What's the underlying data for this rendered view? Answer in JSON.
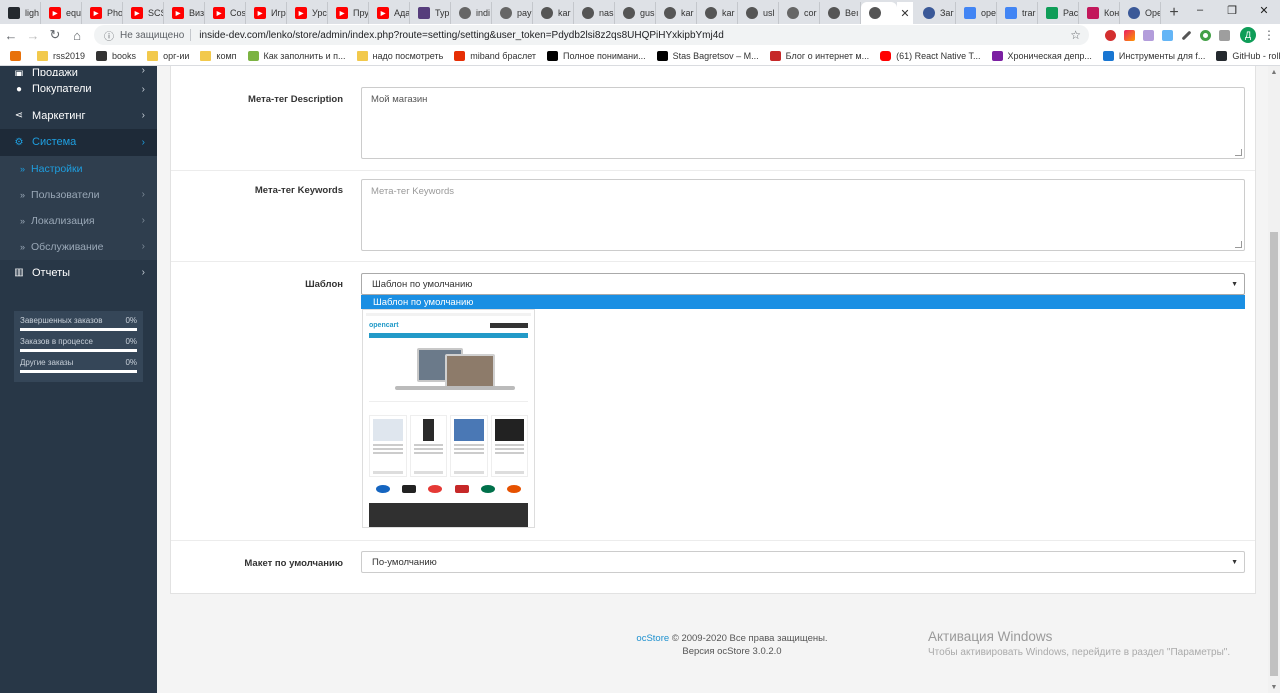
{
  "browser": {
    "tabs": [
      {
        "title": "ligh",
        "icon": "github-icon",
        "color": "#24292e"
      },
      {
        "title": "equ",
        "icon": "youtube-icon",
        "color": "#ff0000"
      },
      {
        "title": "Pho",
        "icon": "youtube-icon",
        "color": "#ff0000"
      },
      {
        "title": "SCS",
        "icon": "youtube-icon",
        "color": "#ff0000"
      },
      {
        "title": "Виз",
        "icon": "youtube-icon",
        "color": "#ff0000"
      },
      {
        "title": "Cos",
        "icon": "youtube-icon",
        "color": "#ff0000"
      },
      {
        "title": "Игр",
        "icon": "youtube-icon",
        "color": "#ff0000"
      },
      {
        "title": "Урс",
        "icon": "youtube-icon",
        "color": "#ff0000"
      },
      {
        "title": "Пру",
        "icon": "youtube-icon",
        "color": "#ff0000"
      },
      {
        "title": "Ада",
        "icon": "youtube-icon",
        "color": "#ff0000"
      },
      {
        "title": "Тур",
        "icon": "bootstrap-icon",
        "color": "#563d7c"
      },
      {
        "title": "indi",
        "icon": "globe-icon",
        "color": "#666666"
      },
      {
        "title": "pay",
        "icon": "globe-icon",
        "color": "#666666"
      },
      {
        "title": "kar",
        "icon": "link-icon",
        "color": "#555555"
      },
      {
        "title": "nas",
        "icon": "link-icon",
        "color": "#555555"
      },
      {
        "title": "gus",
        "icon": "link-icon",
        "color": "#555555"
      },
      {
        "title": "kar",
        "icon": "link-icon",
        "color": "#555555"
      },
      {
        "title": "kar",
        "icon": "link-icon",
        "color": "#555555"
      },
      {
        "title": "usl",
        "icon": "link-icon",
        "color": "#555555"
      },
      {
        "title": "cor",
        "icon": "globe-icon",
        "color": "#666666"
      },
      {
        "title": "Веı",
        "icon": "link-icon",
        "color": "#555555"
      }
    ],
    "tabs_after": [
      {
        "title": "Заг",
        "icon": "opera-icon",
        "color": "#3b5998"
      },
      {
        "title": "ope",
        "icon": "google-icon",
        "color": "#4285f4"
      },
      {
        "title": "trar",
        "icon": "google-icon",
        "color": "#4285f4"
      },
      {
        "title": "Рас",
        "icon": "drive-icon",
        "color": "#0f9d58"
      },
      {
        "title": "Кон",
        "icon": "calendar-icon",
        "color": "#c2185b"
      },
      {
        "title": "Ope",
        "icon": "globe-icon",
        "color": "#3b5998"
      }
    ],
    "close_tab": "✕",
    "new_tab": "+",
    "window_controls": [
      "–",
      "❐",
      "✕"
    ],
    "security_label": "Не защищено",
    "url": "inside-dev.com/lenko/store/admin/index.php?route=setting/setting&user_token=Pdydb2lsi8z2qs8UHQPiHYxkipbYmj4d",
    "profile_initial": "Д",
    "bookmarks": [
      {
        "label": "",
        "icon": "apps-icon",
        "color": "#e8710a"
      },
      {
        "label": "rss2019",
        "icon": "folder-icon",
        "color": "#f2c94c"
      },
      {
        "label": "books",
        "icon": "books-icon",
        "color": "#333333"
      },
      {
        "label": "орг-ии",
        "icon": "folder-icon",
        "color": "#f2c94c"
      },
      {
        "label": "комп",
        "icon": "folder-icon",
        "color": "#f2c94c"
      },
      {
        "label": "Как заполнить и п...",
        "icon": "gear-icon",
        "color": "#7cb342"
      },
      {
        "label": "надо посмотреть",
        "icon": "folder-icon",
        "color": "#f2c94c"
      },
      {
        "label": "miband браслет",
        "icon": "aliexpress-icon",
        "color": "#e62e04"
      },
      {
        "label": "Полное понимани...",
        "icon": "medium-icon",
        "color": "#000000"
      },
      {
        "label": "Stas Bagretsov – M...",
        "icon": "medium-icon",
        "color": "#000000"
      },
      {
        "label": "Блог о интернет м...",
        "icon": "blog-icon",
        "color": "#c62828"
      },
      {
        "label": "(61) React Native T...",
        "icon": "youtube-icon",
        "color": "#ff0000"
      },
      {
        "label": "Хроническая депр...",
        "icon": "briefcase-icon",
        "color": "#7b1fa2"
      },
      {
        "label": "Инструменты для f...",
        "icon": "tools-icon",
        "color": "#1976d2"
      },
      {
        "label": "GitHub - rolling-sco...",
        "icon": "github-icon",
        "color": "#24292e"
      }
    ]
  },
  "sidebar": {
    "items": [
      {
        "label": "Продажи",
        "icon": "cart-icon",
        "glyph": "🛒"
      },
      {
        "label": "Покупатели",
        "icon": "user-icon",
        "glyph": "●"
      },
      {
        "label": "Маркетинг",
        "icon": "share-icon",
        "glyph": "⋖"
      },
      {
        "label": "Система",
        "icon": "gear-icon",
        "glyph": "⚙"
      }
    ],
    "submenu": [
      {
        "label": "Настройки"
      },
      {
        "label": "Пользователи"
      },
      {
        "label": "Локализация"
      },
      {
        "label": "Обслуживание"
      }
    ],
    "reports": {
      "label": "Отчеты",
      "icon": "bar-chart-icon",
      "glyph": "▥"
    },
    "stats": [
      {
        "label": "Завершенных заказов",
        "value": "0%",
        "fill": 0
      },
      {
        "label": "Заказов в процессе",
        "value": "0%",
        "fill": 0
      },
      {
        "label": "Другие заказы",
        "value": "0%",
        "fill": 0
      }
    ]
  },
  "form": {
    "meta_description": {
      "label": "Мета-тег Description",
      "value": "Мой магазин"
    },
    "meta_keywords": {
      "label": "Мета-тег Keywords",
      "placeholder": "Мета-тег Keywords"
    },
    "template": {
      "label": "Шаблон",
      "value": "Шаблон по умолчанию",
      "highlighted_option": "Шаблон по умолчанию"
    },
    "layout": {
      "label": "Макет по умолчанию",
      "value": "По-умолчанию"
    },
    "preview_logo": "opencart"
  },
  "footer": {
    "brand": "ocStore",
    "copyright": "© 2009-2020 Все права защищены.",
    "version": "Версия ocStore 3.0.2.0"
  },
  "windows": {
    "title": "Активация Windows",
    "subtitle": "Чтобы активировать Windows, перейдите в раздел \"Параметры\"."
  }
}
